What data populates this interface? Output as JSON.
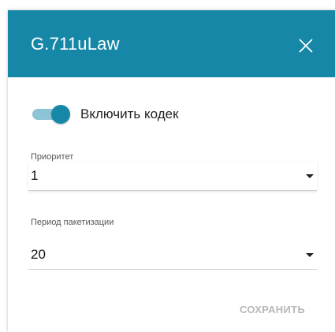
{
  "dialog": {
    "title": "G.711uLaw",
    "close_icon": "close-icon",
    "enable_toggle": {
      "label": "Включить кодек",
      "on": true
    },
    "priority": {
      "label": "Приоритет",
      "value": "1"
    },
    "packetization": {
      "label": "Период пакетизации",
      "value": "20"
    },
    "save_label": "СОХРАНИТЬ"
  },
  "colors": {
    "accent": "#1787a7",
    "toggle_track": "#8cc4d6",
    "disabled_text": "#b8b8b8"
  }
}
